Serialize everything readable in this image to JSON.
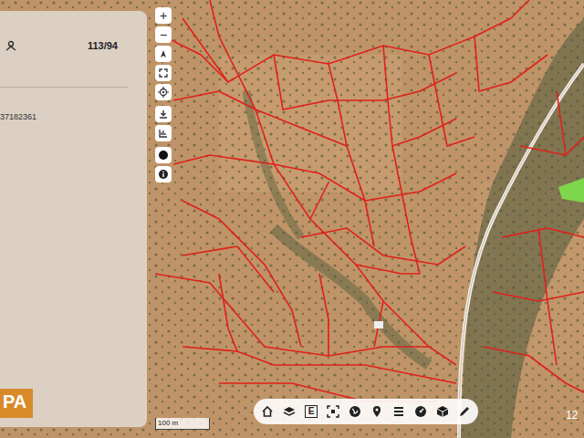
{
  "panel": {
    "parcel_code": "113/94",
    "id_text": "37182361",
    "logo": "PA"
  },
  "zoom_controls": [
    {
      "label": "+"
    },
    {
      "label": "−"
    }
  ],
  "bottom_toolbar": {
    "edit_label": "E"
  },
  "map": {
    "scale": "100 m",
    "corner_text": "12"
  }
}
